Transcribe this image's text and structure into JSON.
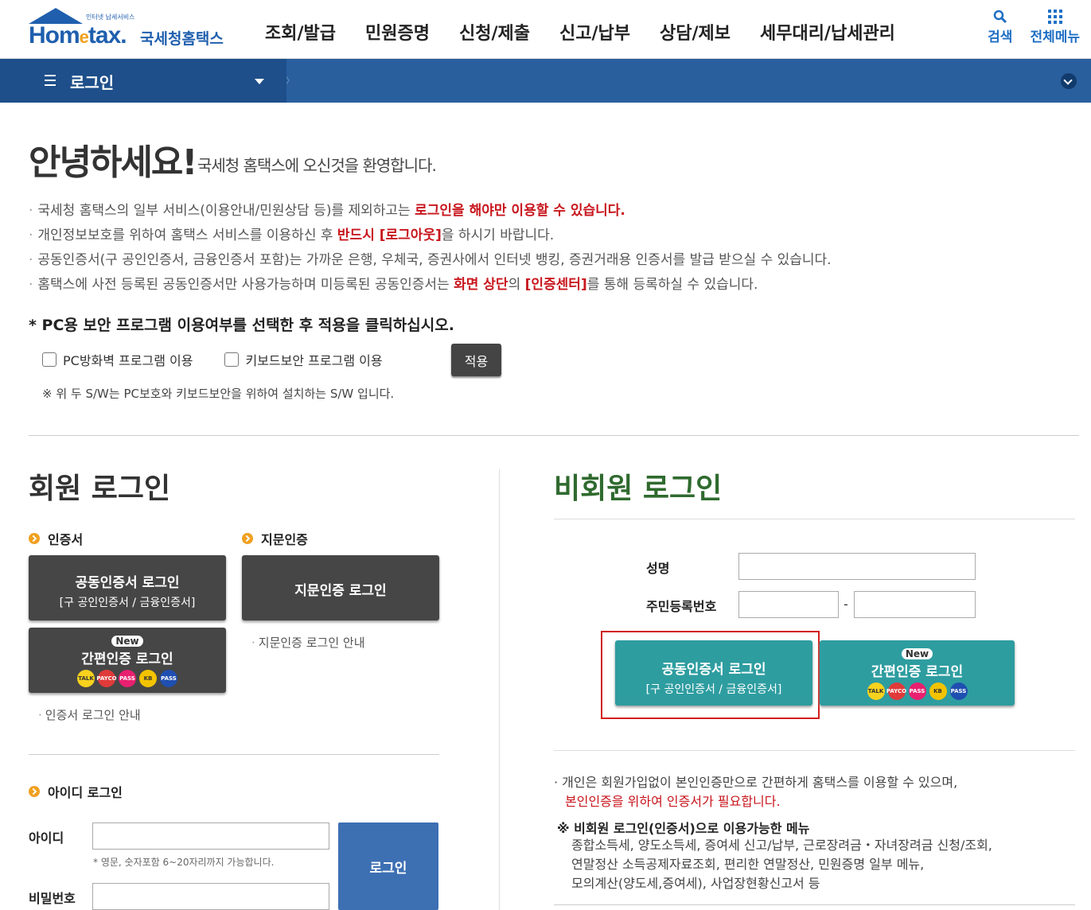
{
  "header": {
    "logo_small": "인터넷 납세서비스",
    "logo_home": "Hom",
    "logo_e": "e",
    "logo_tax": "tax.",
    "logo_kr": "국세청홈택스",
    "gnb": [
      "조회/발급",
      "민원증명",
      "신청/제출",
      "신고/납부",
      "상담/제보",
      "세무대리/납세관리"
    ],
    "search_label": "검색",
    "menu_label": "전체메뉴"
  },
  "navbar": {
    "current": "로그인"
  },
  "greeting": {
    "hello": "안녕하세요!",
    "welcome": "국세청 홈택스에 오신것을 환영합니다."
  },
  "notices": [
    {
      "pre": "국세청 홈택스의 일부 서비스(이용안내/민원상담 등)를 제외하고는 ",
      "red": "로그인을 해야만 이용할 수 있습니다.",
      "post": "",
      "red2": "",
      "post2": ""
    },
    {
      "pre": "개인정보보호를 위하여 홈택스 서비스를 이용하신 후 ",
      "red": "반드시 [로그아웃]",
      "post": "을 하시기 바랍니다.",
      "red2": "",
      "post2": ""
    },
    {
      "pre": "공동인증서(구 공인인증서, 금융인증서 포함)는 가까운 은행, 우체국, 증권사에서 인터넷 뱅킹, 증권거래용 인증서를 발급 받으실 수 있습니다.",
      "red": "",
      "post": "",
      "red2": "",
      "post2": ""
    },
    {
      "pre": "홈택스에 사전 등록된 공동인증서만 사용가능하며 미등록된 공동인증서는 ",
      "red": "화면 상단",
      "post": "의 ",
      "red2": "[인증센터]",
      "post2": "를 통해 등록하실 수 있습니다."
    }
  ],
  "security": {
    "title": "* PC용 보안 프로그램 이용여부를 선택한 후 적용을 클릭하십시오.",
    "firewall": "PC방화벽 프로그램 이용",
    "keyboard": "키보드보안 프로그램 이용",
    "apply": "적용",
    "note": "※ 위 두 S/W는 PC보호와 키보드보안을 위하여 설치하는 S/W 입니다."
  },
  "member": {
    "title": "회원 로그인",
    "cert_heading": "인증서",
    "finger_heading": "지문인증",
    "cert_btn_l1": "공동인증서 로그인",
    "cert_btn_l2": "[구 공인인증서 / 금융인증서]",
    "finger_btn": "지문인증 로그인",
    "new_badge": "New",
    "simple_btn": "간편인증 로그인",
    "finger_guide": "지문인증 로그인 안내",
    "cert_guide": "인증서 로그인 안내",
    "id_heading": "아이디 로그인",
    "id_label": "아이디",
    "pw_label": "비밀번호",
    "id_hint": "* 영문, 숫자포함 6~20자리까지 가능합니다.",
    "login_btn": "로그인"
  },
  "nonmember": {
    "title": "비회원 로그인",
    "name_label": "성명",
    "rrn_label": "주민등록번호",
    "dash": "-",
    "cert_btn_l1": "공동인증서 로그인",
    "cert_btn_l2": "[구 공인인증서 / 금융인증서]",
    "new_badge": "New",
    "simple_btn": "간편인증 로그인",
    "notice_l1": "· 개인은 회원가입없이 본인인증만으로 간편하게 홈택스를 이용할 수 있으며,",
    "notice_l2": "본인인증을 위하여 인증서가 필요합니다.",
    "menu_title": "※ 비회원 로그인(인증서)으로 이용가능한 메뉴",
    "menu_l1": "종합소득세, 양도소득세, 증여세 신고/납부, 근로장려금・자녀장려금 신청/조회,",
    "menu_l2": "연말정산 소득공제자료조회, 편리한 연말정산, 민원증명 일부 메뉴,",
    "menu_l3": "모의계산(양도세,증여세), 사업장현황신고서 등"
  },
  "auth_icons": [
    {
      "name": "kakao",
      "label": "TALK",
      "color": "#f7d21e"
    },
    {
      "name": "samsung-pass",
      "label": "PAYCO",
      "color": "#e03a3a"
    },
    {
      "name": "pass",
      "label": "PASS",
      "color": "#e8206f"
    },
    {
      "name": "kb",
      "label": "KB",
      "color": "#f3c300"
    },
    {
      "name": "payco",
      "label": "PASS",
      "color": "#1f4fb0"
    }
  ]
}
